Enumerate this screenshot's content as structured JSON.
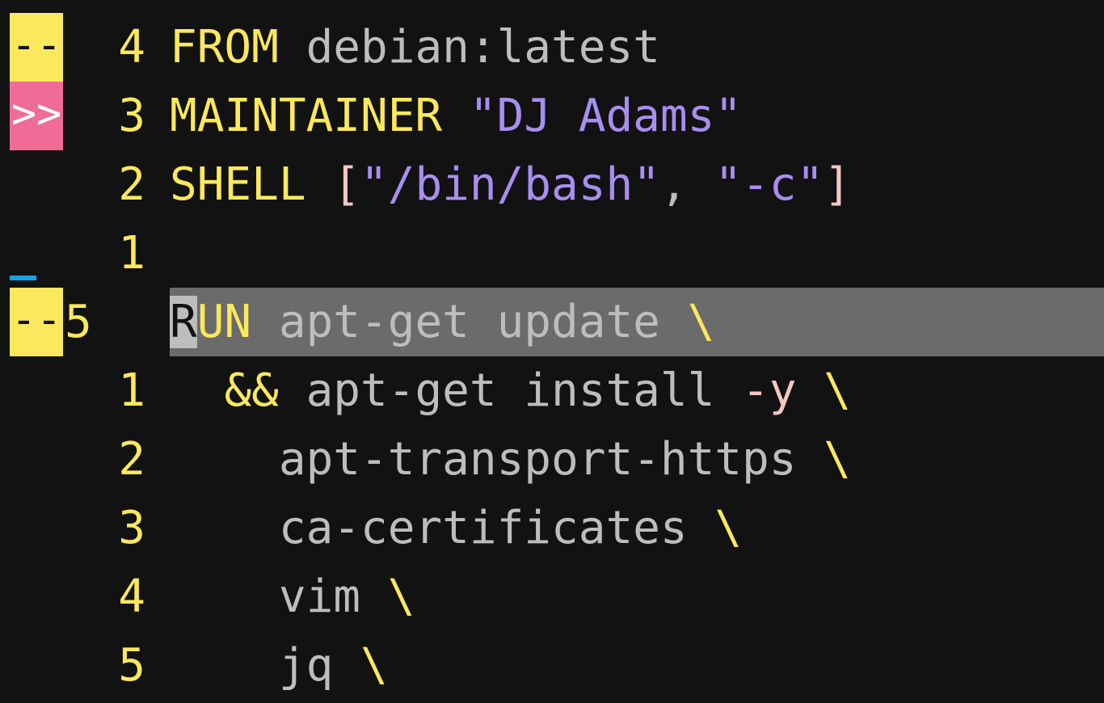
{
  "editor": {
    "colors": {
      "background": "#121212",
      "linenr": "#fce85c",
      "keyword": "#fce85c",
      "string": "#a88ef0",
      "plain": "#bdbdbd",
      "cursorline": "#6b6b6b",
      "sign_warning": "#fce85c",
      "sign_error": "#f06b95",
      "sign_info": "#12a3e8"
    },
    "lines": [
      {
        "sign": "--",
        "sign_type": "warning",
        "number": "4",
        "tokens": [
          {
            "t": "FROM",
            "c": "kw"
          },
          {
            "t": " ",
            "c": "plain"
          },
          {
            "t": "debian:latest",
            "c": "plain"
          }
        ]
      },
      {
        "sign": ">>",
        "sign_type": "error",
        "number": "3",
        "tokens": [
          {
            "t": "MAINTAINER",
            "c": "kw"
          },
          {
            "t": " ",
            "c": "plain"
          },
          {
            "t": "\"DJ Adams\"",
            "c": "str"
          }
        ]
      },
      {
        "sign": "",
        "sign_type": "none",
        "number": "2",
        "tokens": [
          {
            "t": "SHELL",
            "c": "kw"
          },
          {
            "t": " ",
            "c": "plain"
          },
          {
            "t": "[",
            "c": "brk"
          },
          {
            "t": "\"/bin/bash\"",
            "c": "str"
          },
          {
            "t": ", ",
            "c": "plain"
          },
          {
            "t": "\"-c\"",
            "c": "str"
          },
          {
            "t": "]",
            "c": "brk"
          }
        ]
      },
      {
        "sign": "",
        "sign_type": "info",
        "number": "1",
        "tokens": []
      },
      {
        "sign": "--",
        "sign_type": "warning",
        "number": "5",
        "current": true,
        "tokens": [
          {
            "t": "R",
            "c": "cursor"
          },
          {
            "t": "UN",
            "c": "kw"
          },
          {
            "t": " ",
            "c": "plain"
          },
          {
            "t": "apt-get update",
            "c": "plain"
          },
          {
            "t": " ",
            "c": "plain"
          },
          {
            "t": "\\",
            "c": "op"
          }
        ]
      },
      {
        "sign": "",
        "sign_type": "none",
        "number": "1",
        "tokens": [
          {
            "t": "  ",
            "c": "plain"
          },
          {
            "t": "&&",
            "c": "op"
          },
          {
            "t": " apt-get install ",
            "c": "plain"
          },
          {
            "t": "-y",
            "c": "flag"
          },
          {
            "t": " ",
            "c": "plain"
          },
          {
            "t": "\\",
            "c": "op"
          }
        ]
      },
      {
        "sign": "",
        "sign_type": "none",
        "number": "2",
        "tokens": [
          {
            "t": "    apt-transport-https ",
            "c": "plain"
          },
          {
            "t": "\\",
            "c": "op"
          }
        ]
      },
      {
        "sign": "",
        "sign_type": "none",
        "number": "3",
        "tokens": [
          {
            "t": "    ca-certificates ",
            "c": "plain"
          },
          {
            "t": "\\",
            "c": "op"
          }
        ]
      },
      {
        "sign": "",
        "sign_type": "none",
        "number": "4",
        "tokens": [
          {
            "t": "    vim ",
            "c": "plain"
          },
          {
            "t": "\\",
            "c": "op"
          }
        ]
      },
      {
        "sign": "",
        "sign_type": "none",
        "number": "5",
        "tokens": [
          {
            "t": "    jq ",
            "c": "plain"
          },
          {
            "t": "\\",
            "c": "op"
          }
        ]
      }
    ]
  }
}
